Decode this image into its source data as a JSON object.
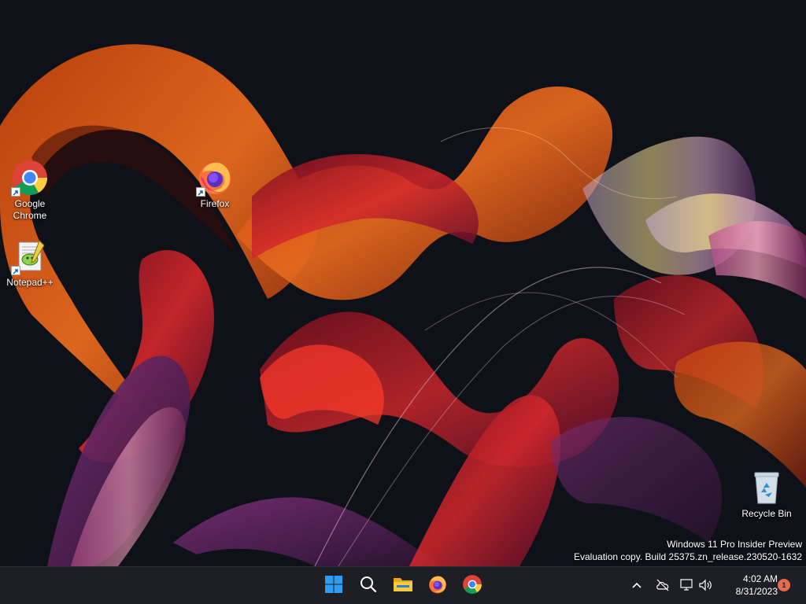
{
  "desktop": {
    "icons": [
      {
        "label": "Google Chrome",
        "icon": "chrome-icon"
      },
      {
        "label": "Firefox",
        "icon": "firefox-icon"
      },
      {
        "label": "Notepad++",
        "icon": "notepadpp-icon"
      },
      {
        "label": "Recycle Bin",
        "icon": "recycle-bin-icon"
      }
    ],
    "watermark": {
      "line1": "Windows 11 Pro Insider Preview",
      "line2": "Evaluation copy. Build 25375.zn_release.230520-1632"
    }
  },
  "taskbar": {
    "pinned": [
      {
        "name": "start",
        "icon": "windows-start-icon"
      },
      {
        "name": "search",
        "icon": "search-icon"
      },
      {
        "name": "file-explorer",
        "icon": "folder-icon"
      },
      {
        "name": "firefox",
        "icon": "firefox-icon"
      },
      {
        "name": "chrome",
        "icon": "chrome-icon"
      }
    ],
    "tray": {
      "icons": [
        "chevron-up-icon",
        "cloud-offline-icon",
        "network-icon",
        "volume-icon"
      ]
    },
    "clock": {
      "time": "4:02 AM",
      "date": "8/31/2023"
    },
    "notifications": {
      "count": "1"
    }
  },
  "colors": {
    "taskbar_bg": "#1d1f24",
    "desktop_bg": "#0f1119",
    "accent": "#e76a4e",
    "windows_blue": "#2f9cf3"
  }
}
